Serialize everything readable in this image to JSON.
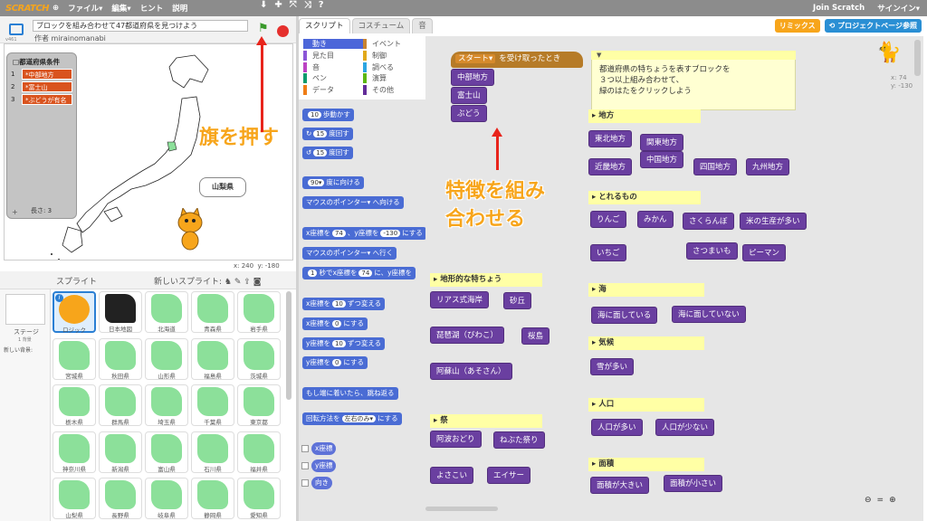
{
  "menubar": {
    "logo": "SCRATCH",
    "items": [
      "ファイル▾",
      "編集▾",
      "ヒント",
      "説明"
    ],
    "join": "Join Scratch",
    "signin": "サインイン▾"
  },
  "project": {
    "title": "ブロックを組み合わせて47都道府県を見つけよう",
    "author": "作者 mirainomanabi",
    "version": "v461"
  },
  "stage": {
    "list_title": "□都道府県条件",
    "list_items": [
      "*中部地方",
      "*富士山",
      "*ぶどうが有名"
    ],
    "list_length": "長さ: 3",
    "bubble": "山梨県",
    "coords_x": "x: 240",
    "coords_y": "y: -180"
  },
  "sprites": {
    "header": "スプライト",
    "new_sprite": "新しいスプライト:",
    "stage_label": "ステージ",
    "stage_bg": "1 背景",
    "new_bg": "新しい背景:",
    "items": [
      "ロジック",
      "日本地図",
      "北海道",
      "青森県",
      "岩手県",
      "宮城県",
      "秋田県",
      "山形県",
      "福島県",
      "茨城県",
      "栃木県",
      "群馬県",
      "埼玉県",
      "千葉県",
      "東京都",
      "神奈川県",
      "新潟県",
      "富山県",
      "石川県",
      "福井県",
      "山梨県",
      "長野県",
      "岐阜県",
      "静岡県",
      "愛知県"
    ]
  },
  "tabs": [
    "スクリプト",
    "コスチューム",
    "音"
  ],
  "categories": [
    {
      "name": "動き",
      "color": "#4c66d9"
    },
    {
      "name": "イベント",
      "color": "#c88330"
    },
    {
      "name": "見た目",
      "color": "#8a55d7"
    },
    {
      "name": "制御",
      "color": "#e1a91a"
    },
    {
      "name": "音",
      "color": "#bb42c3"
    },
    {
      "name": "調べる",
      "color": "#2ca5e2"
    },
    {
      "name": "ペン",
      "color": "#0e9a6c"
    },
    {
      "name": "演算",
      "color": "#5cb712"
    },
    {
      "name": "データ",
      "color": "#ee7d16"
    },
    {
      "name": "その他",
      "color": "#632d99"
    }
  ],
  "palette": {
    "b1": {
      "pre": "",
      "n1": "10",
      "post": "歩動かす"
    },
    "b2": {
      "n1": "15",
      "post": "度回す"
    },
    "b3": {
      "n1": "15",
      "post": "度回す"
    },
    "b4": {
      "n1": "90▾",
      "post": "度に向ける"
    },
    "b5": "マウスのポインター▾ へ向ける",
    "b6": {
      "pre": "x座標を",
      "n1": "74",
      "mid": "、y座標を",
      "n2": "-130",
      "post": "にする"
    },
    "b7": "マウスのポインター▾ へ行く",
    "b8": {
      "n1": "1",
      "pre": "秒でx座標を",
      "n2": "74",
      "post": "に、y座標を"
    },
    "b9": {
      "pre": "x座標を",
      "n1": "10",
      "post": "ずつ変える"
    },
    "b10": {
      "pre": "x座標を",
      "n1": "0",
      "post": "にする"
    },
    "b11": {
      "pre": "y座標を",
      "n1": "10",
      "post": "ずつ変える"
    },
    "b12": {
      "pre": "y座標を",
      "n1": "0",
      "post": "にする"
    },
    "b13": "もし端に着いたら、跳ね返る",
    "b14": {
      "pre": "回転方法を",
      "n1": "左右のみ▾",
      "post": "にする"
    },
    "r1": "x座標",
    "r2": "y座標",
    "r3": "向き"
  },
  "buttons": {
    "remix": "リミックス",
    "see_project": "プロジェクトページ参照"
  },
  "scripts": {
    "hat_dropdown": "スタート▾",
    "hat_text": "を受け取ったとき",
    "stack": [
      "中部地方",
      "富士山",
      "ぶどう"
    ],
    "comment": [
      "都道府県の特ちょうを表すブロックを",
      "３つ以上組み合わせて、",
      "緑のはたをクリックしよう"
    ],
    "sections": {
      "region": "地方",
      "produce": "とれるもの",
      "terrain": "地形的な特ちょう",
      "sea": "海",
      "climate": "気候",
      "festival": "祭",
      "population": "人口",
      "area": "面積"
    },
    "region_blocks": [
      "東北地方",
      "関東地方",
      "近畿地方",
      "中国地方",
      "四国地方",
      "九州地方"
    ],
    "produce_blocks": [
      "りんご",
      "みかん",
      "さくらんぼ",
      "米の生産が多い",
      "いちご",
      "さつまいも",
      "ピーマン"
    ],
    "terrain_blocks": [
      "リアス式海岸",
      "砂丘",
      "琵琶湖（びわこ）",
      "桜島",
      "阿蘇山（あそさん）"
    ],
    "sea_blocks": [
      "海に面している",
      "海に面していない"
    ],
    "climate_blocks": [
      "雪が多い"
    ],
    "festival_blocks": [
      "阿波おどり",
      "ねぶた祭り",
      "よさこい",
      "エイサー"
    ],
    "population_blocks": [
      "人口が多い",
      "人口が少ない"
    ],
    "area_blocks": [
      "面積が大きい",
      "面積が小さい"
    ],
    "sprite_x": "x: 74",
    "sprite_y": "y: -130"
  },
  "annotations": {
    "flag": "旗を押す",
    "combine_1": "特徴を組み",
    "combine_2": "合わせる"
  }
}
